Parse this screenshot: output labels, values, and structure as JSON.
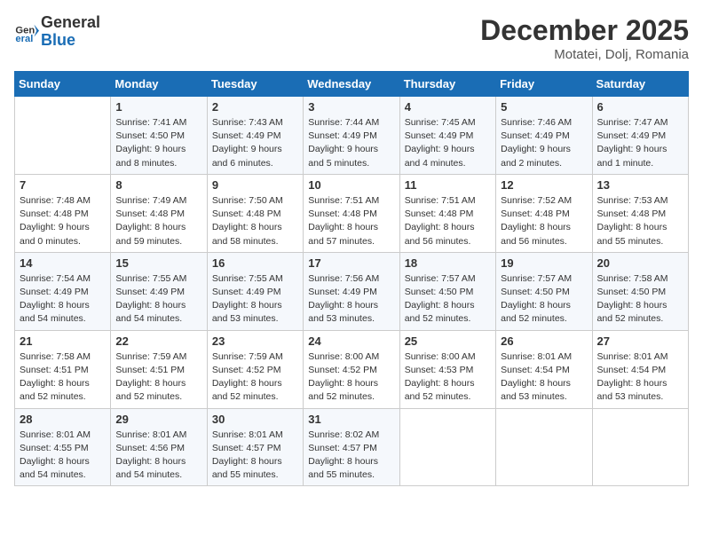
{
  "header": {
    "logo_line1": "General",
    "logo_line2": "Blue",
    "month": "December 2025",
    "location": "Motatei, Dolj, Romania"
  },
  "weekdays": [
    "Sunday",
    "Monday",
    "Tuesday",
    "Wednesday",
    "Thursday",
    "Friday",
    "Saturday"
  ],
  "weeks": [
    [
      {
        "day": "",
        "empty": true
      },
      {
        "day": "1",
        "sunrise": "7:41 AM",
        "sunset": "4:50 PM",
        "daylight": "9 hours and 8 minutes."
      },
      {
        "day": "2",
        "sunrise": "7:43 AM",
        "sunset": "4:49 PM",
        "daylight": "9 hours and 6 minutes."
      },
      {
        "day": "3",
        "sunrise": "7:44 AM",
        "sunset": "4:49 PM",
        "daylight": "9 hours and 5 minutes."
      },
      {
        "day": "4",
        "sunrise": "7:45 AM",
        "sunset": "4:49 PM",
        "daylight": "9 hours and 4 minutes."
      },
      {
        "day": "5",
        "sunrise": "7:46 AM",
        "sunset": "4:49 PM",
        "daylight": "9 hours and 2 minutes."
      },
      {
        "day": "6",
        "sunrise": "7:47 AM",
        "sunset": "4:49 PM",
        "daylight": "9 hours and 1 minute."
      }
    ],
    [
      {
        "day": "7",
        "sunrise": "7:48 AM",
        "sunset": "4:48 PM",
        "daylight": "9 hours and 0 minutes."
      },
      {
        "day": "8",
        "sunrise": "7:49 AM",
        "sunset": "4:48 PM",
        "daylight": "8 hours and 59 minutes."
      },
      {
        "day": "9",
        "sunrise": "7:50 AM",
        "sunset": "4:48 PM",
        "daylight": "8 hours and 58 minutes."
      },
      {
        "day": "10",
        "sunrise": "7:51 AM",
        "sunset": "4:48 PM",
        "daylight": "8 hours and 57 minutes."
      },
      {
        "day": "11",
        "sunrise": "7:51 AM",
        "sunset": "4:48 PM",
        "daylight": "8 hours and 56 minutes."
      },
      {
        "day": "12",
        "sunrise": "7:52 AM",
        "sunset": "4:48 PM",
        "daylight": "8 hours and 56 minutes."
      },
      {
        "day": "13",
        "sunrise": "7:53 AM",
        "sunset": "4:48 PM",
        "daylight": "8 hours and 55 minutes."
      }
    ],
    [
      {
        "day": "14",
        "sunrise": "7:54 AM",
        "sunset": "4:49 PM",
        "daylight": "8 hours and 54 minutes."
      },
      {
        "day": "15",
        "sunrise": "7:55 AM",
        "sunset": "4:49 PM",
        "daylight": "8 hours and 54 minutes."
      },
      {
        "day": "16",
        "sunrise": "7:55 AM",
        "sunset": "4:49 PM",
        "daylight": "8 hours and 53 minutes."
      },
      {
        "day": "17",
        "sunrise": "7:56 AM",
        "sunset": "4:49 PM",
        "daylight": "8 hours and 53 minutes."
      },
      {
        "day": "18",
        "sunrise": "7:57 AM",
        "sunset": "4:50 PM",
        "daylight": "8 hours and 52 minutes."
      },
      {
        "day": "19",
        "sunrise": "7:57 AM",
        "sunset": "4:50 PM",
        "daylight": "8 hours and 52 minutes."
      },
      {
        "day": "20",
        "sunrise": "7:58 AM",
        "sunset": "4:50 PM",
        "daylight": "8 hours and 52 minutes."
      }
    ],
    [
      {
        "day": "21",
        "sunrise": "7:58 AM",
        "sunset": "4:51 PM",
        "daylight": "8 hours and 52 minutes."
      },
      {
        "day": "22",
        "sunrise": "7:59 AM",
        "sunset": "4:51 PM",
        "daylight": "8 hours and 52 minutes."
      },
      {
        "day": "23",
        "sunrise": "7:59 AM",
        "sunset": "4:52 PM",
        "daylight": "8 hours and 52 minutes."
      },
      {
        "day": "24",
        "sunrise": "8:00 AM",
        "sunset": "4:52 PM",
        "daylight": "8 hours and 52 minutes."
      },
      {
        "day": "25",
        "sunrise": "8:00 AM",
        "sunset": "4:53 PM",
        "daylight": "8 hours and 52 minutes."
      },
      {
        "day": "26",
        "sunrise": "8:01 AM",
        "sunset": "4:54 PM",
        "daylight": "8 hours and 53 minutes."
      },
      {
        "day": "27",
        "sunrise": "8:01 AM",
        "sunset": "4:54 PM",
        "daylight": "8 hours and 53 minutes."
      }
    ],
    [
      {
        "day": "28",
        "sunrise": "8:01 AM",
        "sunset": "4:55 PM",
        "daylight": "8 hours and 54 minutes."
      },
      {
        "day": "29",
        "sunrise": "8:01 AM",
        "sunset": "4:56 PM",
        "daylight": "8 hours and 54 minutes."
      },
      {
        "day": "30",
        "sunrise": "8:01 AM",
        "sunset": "4:57 PM",
        "daylight": "8 hours and 55 minutes."
      },
      {
        "day": "31",
        "sunrise": "8:02 AM",
        "sunset": "4:57 PM",
        "daylight": "8 hours and 55 minutes."
      },
      {
        "day": "",
        "empty": true
      },
      {
        "day": "",
        "empty": true
      },
      {
        "day": "",
        "empty": true
      }
    ]
  ]
}
